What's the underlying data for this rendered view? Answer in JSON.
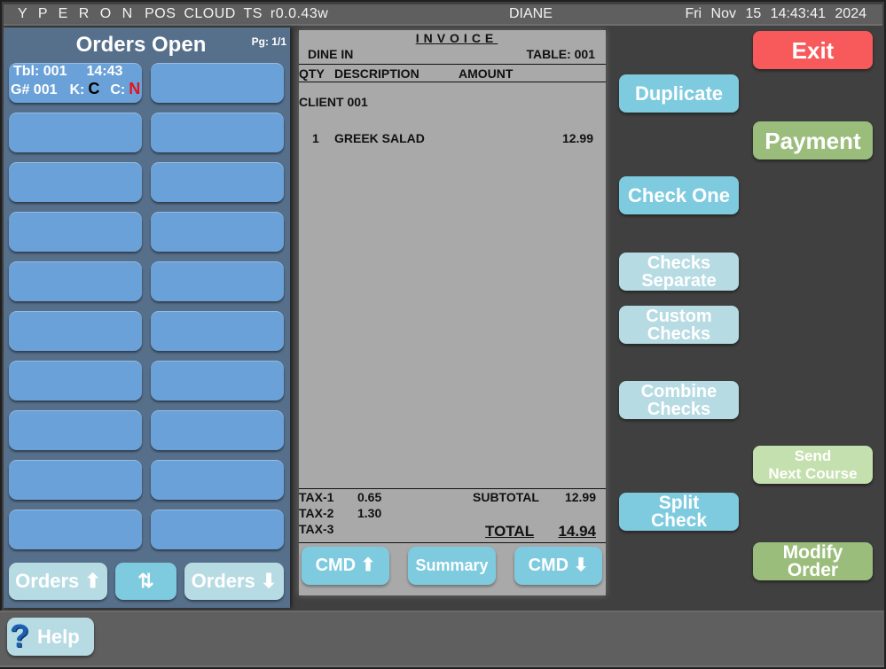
{
  "topbar": {
    "app_name_spaced": "Y P E R O N",
    "app_name_rest": "POS  CLOUD  TS  r0.0.43w",
    "user": "DIANE",
    "clock": "Fri  Nov  15  14:43:41  2024"
  },
  "orders": {
    "title": "Orders Open",
    "page": "Pg: 1/1",
    "open_orders": [
      {
        "table_label": "Tbl: 001",
        "time": "14:43",
        "guest_label": "G# 001",
        "k_label": "K:",
        "k_value": "C",
        "c_label": "C:",
        "c_value": "N"
      }
    ],
    "slots_total": 20,
    "nav": {
      "up_label": "Orders ⬆",
      "swap_label": "⇅",
      "down_label": "Orders ⬇"
    }
  },
  "invoice": {
    "title": "INVOICE",
    "order_type": "DINE IN",
    "table": "TABLE: 001",
    "columns": {
      "qty": "QTY",
      "description": "DESCRIPTION",
      "amount": "AMOUNT"
    },
    "client": "CLIENT 001",
    "items": [
      {
        "qty": "1",
        "description": "GREEK SALAD",
        "amount": "12.99"
      }
    ],
    "taxes": [
      {
        "label": "TAX-1",
        "value": "0.65"
      },
      {
        "label": "TAX-2",
        "value": "1.30"
      },
      {
        "label": "TAX-3",
        "value": ""
      }
    ],
    "subtotal_label": "SUBTOTAL",
    "subtotal": "12.99",
    "total_label": "TOTAL",
    "total": "14.94",
    "buttons": {
      "cmd_up": "CMD ⬆",
      "summary": "Summary",
      "cmd_down": "CMD ⬇"
    }
  },
  "actions": {
    "exit": "Exit",
    "duplicate": "Duplicate",
    "payment": "Payment",
    "check_one": "Check One",
    "checks_separate": [
      "Checks",
      "Separate"
    ],
    "custom_checks": [
      "Custom",
      "Checks"
    ],
    "combine_checks": [
      "Combine",
      "Checks"
    ],
    "send_next_course": [
      "Send",
      "Next Course"
    ],
    "split_check": [
      "Split",
      "Check"
    ],
    "modify_order": [
      "Modify",
      "Order"
    ]
  },
  "footer": {
    "help_icon": "?",
    "help_label": "Help"
  },
  "colors": {
    "exit": "#f85a5c",
    "primary": "#7ecbdf",
    "disabled": "#b7dbe3",
    "payment": "#9bbd7c",
    "order_slot": "#6aa1d8"
  }
}
